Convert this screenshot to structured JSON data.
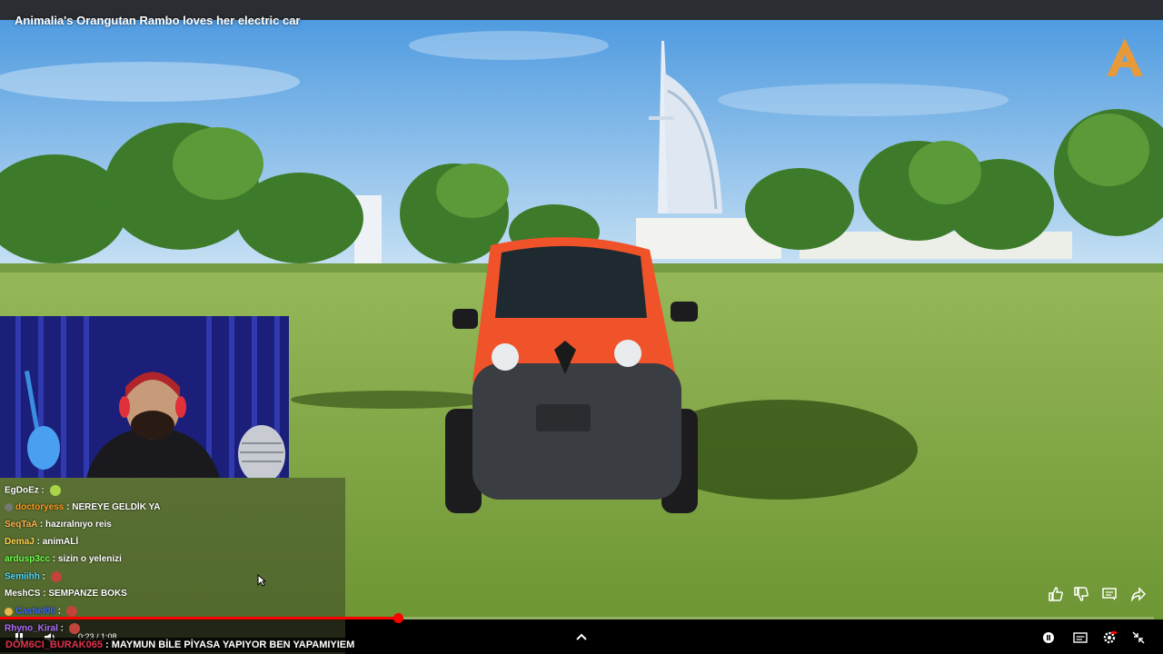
{
  "video": {
    "title": "Animalia's Orangutan Rambo loves her electric car",
    "time_current": "0:23",
    "time_separator": " / ",
    "time_total": "1:08",
    "progress": 0.345
  },
  "chat": {
    "messages": [
      {
        "user": "EgDoEz",
        "sep": " : ",
        "text": "",
        "user_color": "#ffffff",
        "emote": "#a8d44a",
        "badge": ""
      },
      {
        "user": "doctoryess",
        "sep": " : ",
        "text": "NEREYE GELDİK YA",
        "user_color": "#ff9a1a",
        "emote": "",
        "badge": "#777"
      },
      {
        "user": "SeqTaA",
        "sep": " : ",
        "text": "hazıralnıyo reis",
        "user_color": "#ffb04a",
        "emote": "",
        "badge": ""
      },
      {
        "user": "DemaJ",
        "sep": " : ",
        "text": "animALİ",
        "user_color": "#ffd24a",
        "emote": "",
        "badge": ""
      },
      {
        "user": "ardusp3cc",
        "sep": " : ",
        "text": "sizin o yelenizi",
        "user_color": "#6dff4a",
        "emote": "",
        "badge": ""
      },
      {
        "user": "Semiihh",
        "sep": " : ",
        "text": "",
        "user_color": "#4ad6ff",
        "emote": "#c0443a",
        "badge": ""
      },
      {
        "user": "MeshCS",
        "sep": " : ",
        "text": "SEMPANZE BOKS",
        "user_color": "#ffffff",
        "emote": "",
        "badge": ""
      },
      {
        "user": "Castiel06",
        "sep": " : ",
        "text": "",
        "user_color": "#3b6dff",
        "emote": "#c0443a",
        "badge": "#e8b84a"
      },
      {
        "user": "Rhyno_Kiral",
        "sep": " : ",
        "text": "",
        "user_color": "#b06dff",
        "emote": "#c0443a",
        "badge": ""
      }
    ],
    "banner_user": "DOM6CI_BURAK065",
    "banner_sep": " : ",
    "banner_text": "MAYMUN BİLE PİYASA YAPIYOR BEN YAPAMIYIEM"
  },
  "colors": {
    "progress": "#ff0000",
    "car_body": "#f0522a",
    "grass": "#7fa83c",
    "sky": "#58a4e4"
  },
  "icons": [
    "like-icon",
    "dislike-icon",
    "comment-icon",
    "share-icon",
    "play-pause-icon",
    "volume-icon",
    "chevron-up-icon",
    "autoplay-toggle-icon",
    "subtitles-icon",
    "settings-icon",
    "exit-fullscreen-icon",
    "channel-logo-icon"
  ]
}
